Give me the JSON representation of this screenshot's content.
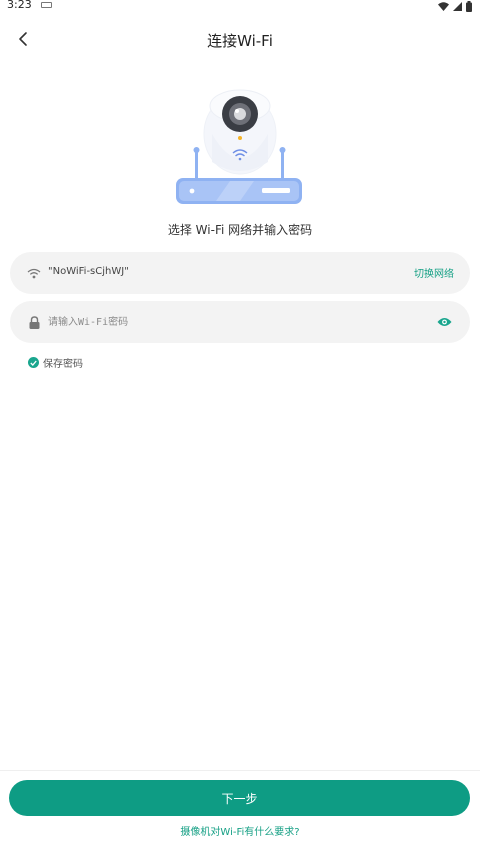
{
  "status_bar": {
    "time": "3:23",
    "icons": [
      "keyboard-icon",
      "wifi-signal-icon",
      "cell-signal-icon",
      "battery-icon"
    ]
  },
  "header": {
    "title": "连接Wi-Fi",
    "back_icon": "chevron-left-icon"
  },
  "illustration": {
    "description_icon": "camera-router-illustration"
  },
  "instruction": "选择 Wi-Fi 网络并输入密码",
  "network_field": {
    "icon": "wifi-icon",
    "ssid": "\"NoWiFi-sCjhWJ\"",
    "switch_label": "切换网络"
  },
  "password_field": {
    "icon": "lock-icon",
    "placeholder": "请输入Wi-Fi密码",
    "value": "",
    "toggle_icon": "eye-icon"
  },
  "save_password": {
    "checked": true,
    "label": "保存密码"
  },
  "footer": {
    "next_label": "下一步",
    "help_link": "摄像机对Wi-Fi有什么要求?"
  },
  "colors": {
    "accent": "#0e9c84",
    "link": "#16a085",
    "field_bg": "#f3f3f3",
    "router": "#8fb2f2"
  }
}
